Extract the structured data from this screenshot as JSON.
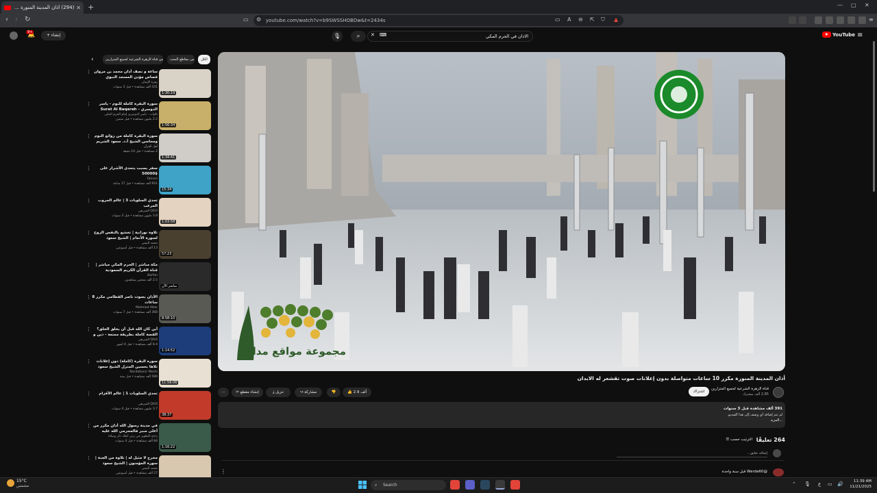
{
  "browser": {
    "tab_title": "(294) أذان المدينة المنورة مكرر",
    "url": "youtube.com/watch?v=b9SWSSHOBDw&t=2434s",
    "new_tab": "+"
  },
  "masthead": {
    "search_query": "الاذان في الحرم المكي",
    "create_label": "إنشاء",
    "notification_count": "9+",
    "logo_text": "YouTube"
  },
  "video": {
    "title": "أذان المدينة المنورة مكرر 10 ساعات متواصلة بدون إعلانات صوت تقشعر له الابدان",
    "watermark": "مجموعة مواقع مداد",
    "channel": {
      "name": "قناة الزهرة الشرعية لجميع المتزارين",
      "subscribers": "2.85 ألف مشترك",
      "subscribe_label": "اشتراك"
    },
    "actions": {
      "likes": "2.9 ألف",
      "share": "مشاركة",
      "download": "تنزيل",
      "clip": "إنشاء مقطع",
      "more": "⋯"
    },
    "description": {
      "views": "391 ألف مشاهدة قبل 3 سنوات",
      "text": "لم تتم إضافة أي وصف إلى هذا الفيديو.",
      "more": "...المزيد"
    }
  },
  "comments": {
    "count": "264 تعليقًا",
    "sort_label": "الترتيب حسب",
    "add_placeholder": "إضافة تعليق...",
    "first_author": "@Warda60 قبل سنة واحدة"
  },
  "sidebar": {
    "chips": [
      "الكل",
      "من مقاطع البحث",
      "من قناة الزهرة الشرعية لجميع المتزارين"
    ],
    "recommendations": [
      {
        "title": "ساعة و نصف أذان محمد بن مروان قصاص مؤذن المسجد النبوي الشريف",
        "channel": "زهرة الإيمان",
        "meta": "431 ألف مشاهدة • قبل 3 سنوات",
        "duration": "1:30:19"
      },
      {
        "title": "سورة البقرة كاملة للنوم - ياسر الدوسري - Surat Al Baqarah طاردة الشياطين",
        "channel": "تلاوات - ياسر الدوسري إمام الحرم المكي",
        "meta": "2.2 مليون مشاهدة • قبل سنتين",
        "duration": "1:56:34"
      },
      {
        "title": "سورة البقرة كاملة من روائع النوم ومحاسن الشيخ أ.د. سعود الشريم Surat Al",
        "channel": "أهل القرآن",
        "meta": "2 مشاهدة • قبل 14 دقيقة",
        "duration": "1:34:41"
      },
      {
        "title": "سفر يسبب يتحدى الأشرار على $50000",
        "channel": "Falconi",
        "meta": "921 ألف مشاهدة • قبل 17 ساعة",
        "duration": "15:34"
      },
      {
        "title": "تحدي السلوبات 3 | عالم الحروب المرعب",
        "channel": "QGO الشريقي",
        "meta": "3.8 مليون مشاهدة • قبل 3 سنوات",
        "duration": "1:03:58"
      },
      {
        "title": "تلاوة نورانية | تخشع بالنفس الروح لسورة الأنعام | الشيخ سعود الشريم saud",
        "channel": "محمد اليمني",
        "meta": "13 ألف مشاهدة • قبل أسبوعين",
        "duration": "57:23"
      },
      {
        "title": "مكة مباشر | الحرم المكي مباشر | قناة القرآن الكريم السعودية Makkah Live",
        "channel": "Barfan",
        "meta": "2.5 ألف شخص يشاهدون",
        "duration": "مباشر الآن"
      },
      {
        "title": "الأذان بصوت ناصر القطامي مكرر 8 ساعات",
        "channel": "Mohmad Attar",
        "meta": "368 ألف مشاهدة • قبل 7 سنوات",
        "duration": "8:58:10"
      },
      {
        "title": "أين كان الله قبل أن يخلق الخلق؟ القصة كاملة بطريقة ممتعة - دين و علوم",
        "channel": "QGO الشريقي",
        "meta": "8.4 ألف مشاهدة • قبل 4 أشهر",
        "duration": "1:14:52"
      },
      {
        "title": "سورة البقرة (كاملة) دون إعلانات تلاها بحسين المنزل الشيخ سعود الشريم surah",
        "channel": "Recitations' Meshi",
        "meta": "589 ألف مشاهدة • قبل سنة",
        "duration": "11:56:06"
      },
      {
        "title": "تحدي السلوبات 1 | عالم الأقزام",
        "channel": "QGO الشريقي",
        "meta": "3.7 مليون مشاهدة • قبل 4 سنوات",
        "duration": "38:37"
      },
      {
        "title": "في مدينة رسول الله أذان مكرر من أعلى منبر فالمحرمي الله عليه",
        "channel": "راجح التطوير في زمن أملك ذكر وصلاة",
        "meta": "84 ألف مشاهدة • قبل 4 سنوات",
        "duration": "1:16:22"
      },
      {
        "title": "مخرج لا مثيل له | تلاوة من الجنة | سورة المؤمنون | الشيخ سعود الشريم saud",
        "channel": "محمد اليمني",
        "meta": "27 ألف مشاهدة • قبل أسبوعين",
        "duration": ""
      }
    ]
  },
  "taskbar": {
    "temperature": "15°C",
    "weather": "مشمس",
    "search": "Search",
    "time": "11:39 AM",
    "date": "11/21/2025"
  },
  "colors": {
    "accent": "#ff0000",
    "background": "#0f0f0f",
    "surface": "#272727"
  }
}
